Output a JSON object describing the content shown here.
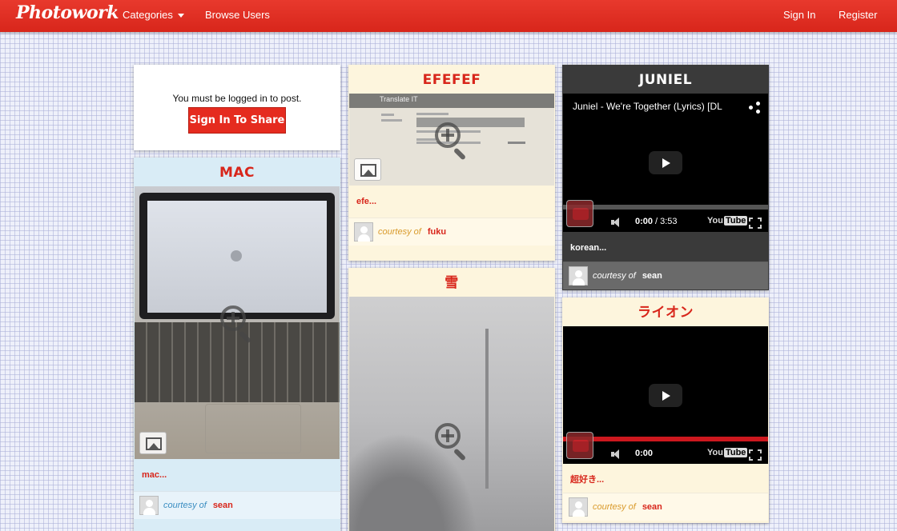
{
  "nav": {
    "brand": "Photowork",
    "categories": "Categories",
    "browse_users": "Browse Users",
    "sign_in": "Sign In",
    "register": "Register"
  },
  "login_card": {
    "message": "You must be logged in to post.",
    "button": "Sign In To Share"
  },
  "cards": {
    "mac": {
      "title": "MAC",
      "caption": "mac...",
      "courtesy": "courtesy of",
      "user": "sean"
    },
    "efefef": {
      "title": "EFEFEF",
      "caption": "efe...",
      "courtesy": "courtesy of",
      "user": "fuku",
      "screenshot_header": "Translate IT"
    },
    "snow": {
      "title": "雪"
    },
    "juniel": {
      "title": "JUNIEL",
      "video_title": "Juniel - We're Together (Lyrics) [DL",
      "time_current": "0:00",
      "time_total": "/ 3:53",
      "caption": "korean...",
      "courtesy": "courtesy of",
      "user": "sean"
    },
    "lion": {
      "title": "ライオン",
      "time_current": "0:00",
      "caption": "超好き...",
      "courtesy": "courtesy of",
      "user": "sean"
    }
  },
  "youtube_logo": {
    "you": "You",
    "tube": "Tube"
  },
  "colors": {
    "brand_red": "#e52b1f",
    "card_cream": "#fdf5dd",
    "card_blue": "#d9ecf6",
    "card_dark": "#3a3a3a"
  },
  "icons": [
    "caret-down-icon",
    "zoom-in-icon",
    "image-icon",
    "avatar-icon",
    "play-icon",
    "share-icon",
    "volume-icon",
    "fullscreen-icon",
    "youtube-logo-icon"
  ]
}
